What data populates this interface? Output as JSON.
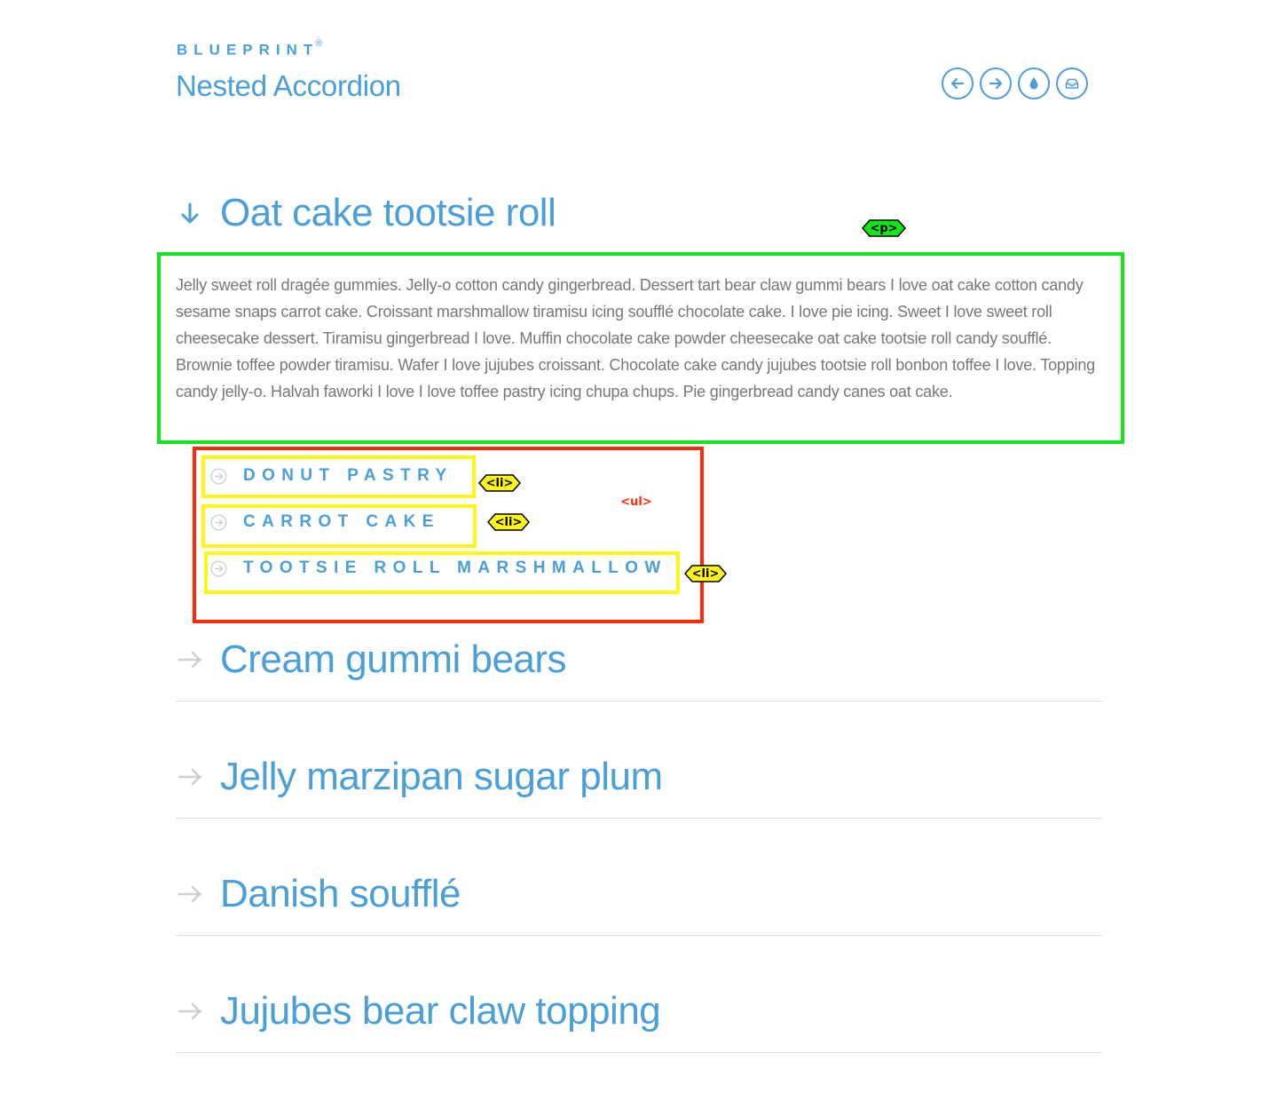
{
  "header": {
    "brand": "BLUEPRINT",
    "brand_mark": "®",
    "title": "Nested Accordion",
    "icons": [
      "arrow-left-icon",
      "arrow-right-icon",
      "drop-icon",
      "inbox-icon"
    ]
  },
  "accordion": {
    "open_section": {
      "title": "Oat cake tootsie roll",
      "text": "Jelly sweet roll dragée gummies. Jelly-o cotton candy gingerbread. Dessert tart bear claw gummi bears I love oat cake cotton candy sesame snaps carrot cake. Croissant marshmallow tiramisu icing soufflé chocolate cake. I love pie icing. Sweet I love sweet roll cheesecake dessert. Tiramisu gingerbread I love. Muffin chocolate cake powder cheesecake oat cake tootsie roll candy soufflé. Brownie toffee powder tiramisu. Wafer I love jujubes croissant. Chocolate cake candy jujubes tootsie roll bonbon toffee I love. Topping candy jelly-o. Halvah faworki I love I love toffee pastry icing chupa chups. Pie gingerbread candy canes oat cake.",
      "sub_items": [
        "DONUT PASTRY",
        "CARROT CAKE",
        "TOOTSIE ROLL MARSHMALLOW"
      ]
    },
    "closed_sections": [
      "Cream gummi bears",
      "Jelly marzipan sugar plum",
      "Danish soufflé",
      "Jujubes bear claw topping"
    ]
  },
  "annotations": {
    "p_tag": "<p>",
    "ul_tag": "<ul>",
    "li_tag": "<li>"
  },
  "colors": {
    "accent": "#4a9fd8",
    "body_text": "#777777",
    "annotation_p": "#11e61a",
    "annotation_ul": "#ff2a0c",
    "annotation_li": "#fff615"
  }
}
